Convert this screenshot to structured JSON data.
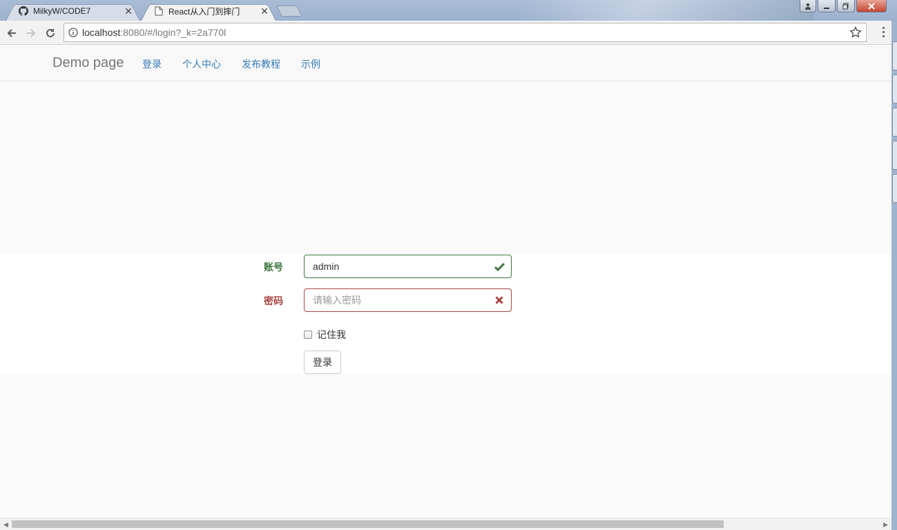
{
  "browser": {
    "tabs": [
      {
        "title": "MilkyW/CODE7",
        "icon": "github-icon",
        "active": false
      },
      {
        "title": "React从入门到摔门",
        "icon": "page-icon",
        "active": true
      }
    ],
    "close_glyph": "✕",
    "window_controls": {
      "user": "👤",
      "minimize": "‒",
      "maximize": "▫",
      "close": "✕"
    },
    "address": {
      "host": "localhost",
      "rest": ":8080/#/login?_k=2a770l"
    }
  },
  "navbar": {
    "brand": "Demo page",
    "links": [
      "登录",
      "个人中心",
      "发布教程",
      "示例"
    ]
  },
  "form": {
    "account": {
      "label": "账号",
      "value": "admin",
      "state": "success",
      "state_icon": "check-icon",
      "color": "#3c763d"
    },
    "password": {
      "label": "密码",
      "value": "",
      "placeholder": "请输入密码",
      "state": "error",
      "state_icon": "times-icon",
      "color": "#a94442"
    },
    "remember": {
      "label": "记住我",
      "checked": false
    },
    "submit_label": "登录"
  },
  "colors": {
    "link": "#337ab7",
    "brand": "#777777"
  },
  "scrollbar": {
    "horizontal_visible_fraction": 0.82
  }
}
